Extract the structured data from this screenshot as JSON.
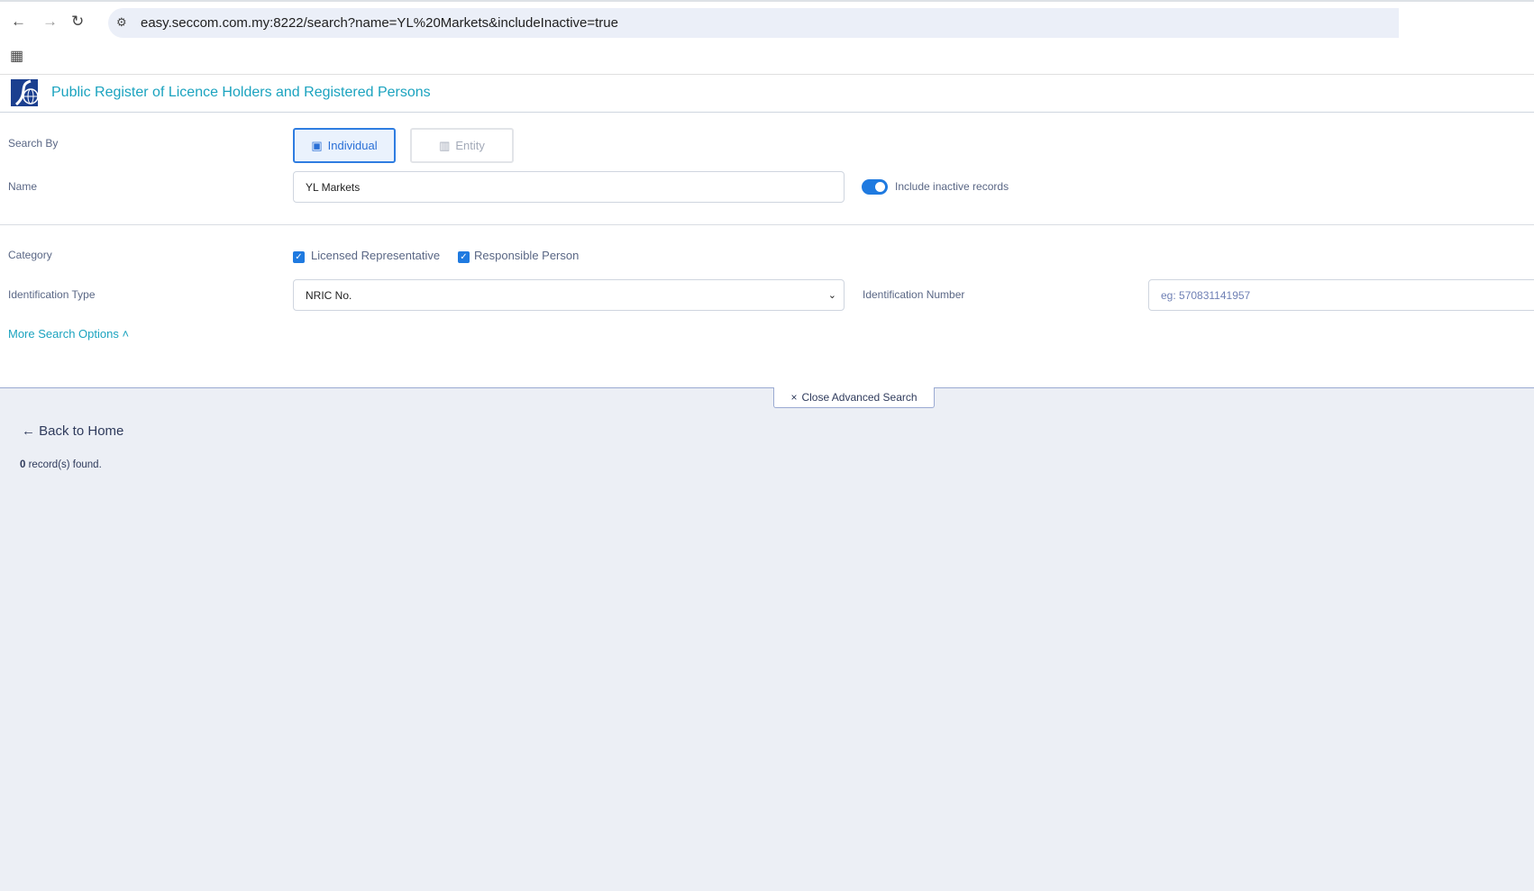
{
  "browser": {
    "url": "easy.seccom.com.my:8222/search?name=YL%20Markets&includeInactive=true"
  },
  "header": {
    "title": "Public Register of Licence Holders and Registered Persons"
  },
  "form": {
    "search_by_label": "Search By",
    "individual_label": "Individual",
    "entity_label": "Entity",
    "name_label": "Name",
    "name_value": "YL Markets",
    "include_inactive_label": "Include inactive records",
    "include_inactive": true,
    "category_label": "Category",
    "categories": [
      {
        "label": "Licensed Representative",
        "checked": true
      },
      {
        "label": "Responsible Person",
        "checked": true
      }
    ],
    "id_type_label": "Identification Type",
    "id_type_value": "NRIC No.",
    "id_number_label": "Identification Number",
    "id_number_placeholder": "eg: 570831141957",
    "more_options": "More Search Options"
  },
  "results": {
    "close_advanced": "Close Advanced Search",
    "back_home": "Back to Home",
    "count": "0",
    "records_suffix": " record(s) found."
  }
}
